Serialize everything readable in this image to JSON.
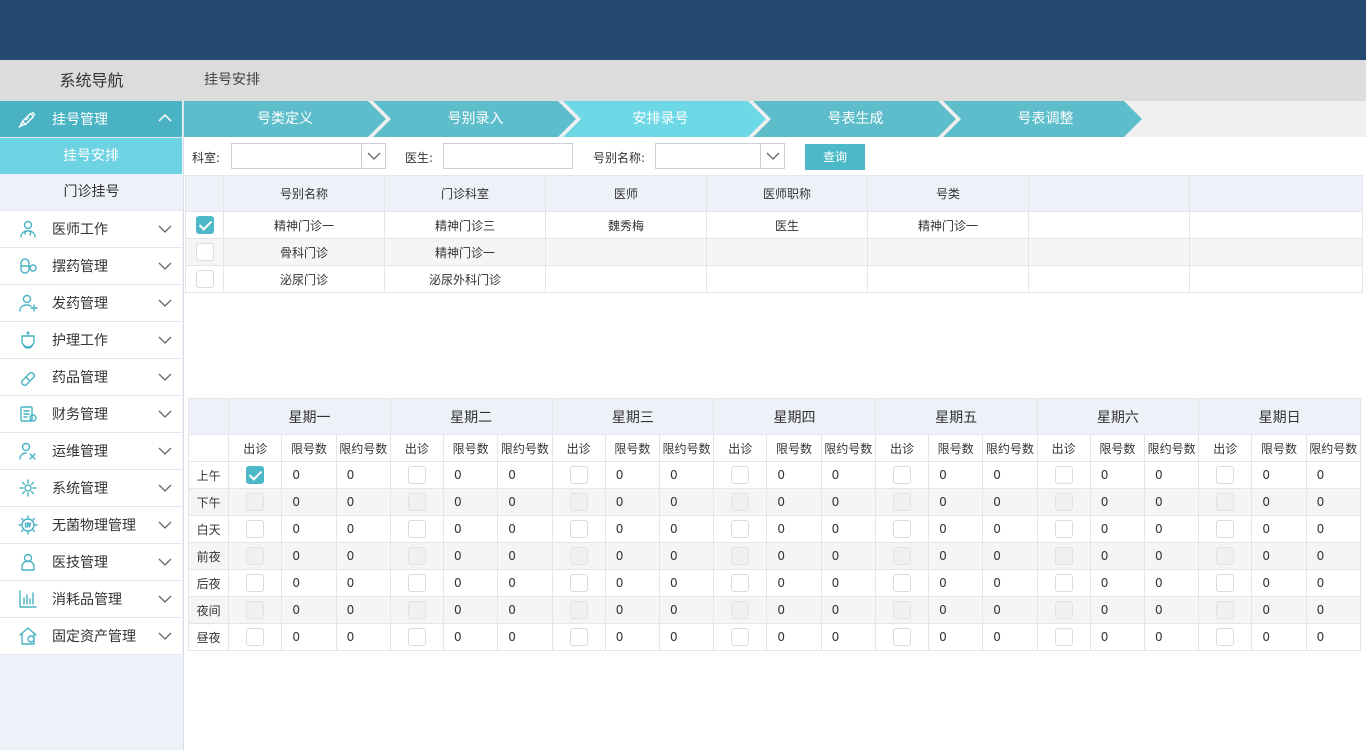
{
  "sidebar": {
    "title": "系统导航",
    "active_group": "挂号管理",
    "active_sub": "挂号安排",
    "sub_plain": "门诊挂号",
    "items": [
      {
        "label": "医师工作",
        "icon": "doctor-icon"
      },
      {
        "label": "摆药管理",
        "icon": "pill-icon"
      },
      {
        "label": "发药管理",
        "icon": "dispense-icon"
      },
      {
        "label": "护理工作",
        "icon": "nurse-icon"
      },
      {
        "label": "药品管理",
        "icon": "capsule-icon"
      },
      {
        "label": "财务管理",
        "icon": "finance-icon"
      },
      {
        "label": "运维管理",
        "icon": "maintenance-icon"
      },
      {
        "label": "系统管理",
        "icon": "gear-icon"
      },
      {
        "label": "无菌物理管理",
        "icon": "uv-icon"
      },
      {
        "label": "医技管理",
        "icon": "technician-icon"
      },
      {
        "label": "消耗品管理",
        "icon": "chart-bars-icon"
      },
      {
        "label": "固定资产管理",
        "icon": "house-money-icon"
      }
    ]
  },
  "breadcrumb": "挂号安排",
  "steps": [
    {
      "label": "号类定义",
      "active": false
    },
    {
      "label": "号别录入",
      "active": false
    },
    {
      "label": "安排录号",
      "active": true
    },
    {
      "label": "号表生成",
      "active": false
    },
    {
      "label": "号表调整",
      "active": false
    }
  ],
  "filters": {
    "dept_label": "科室:",
    "doctor_label": "医生:",
    "name_label": "号别名称:",
    "dept_value": "",
    "doctor_value": "",
    "name_value": "",
    "query_button": "查询"
  },
  "reg_table": {
    "headers": [
      "号别名称",
      "门诊科室",
      "医师",
      "医师职称",
      "号类",
      "",
      ""
    ],
    "rows": [
      {
        "checked": true,
        "cells": [
          "精神门诊一",
          "精神门诊三",
          "魏秀梅",
          "医生",
          "精神门诊一",
          "",
          ""
        ]
      },
      {
        "checked": false,
        "cells": [
          "骨科门诊",
          "精神门诊一",
          "",
          "",
          "",
          "",
          ""
        ]
      },
      {
        "checked": false,
        "cells": [
          "泌尿门诊",
          "泌尿外科门诊",
          "",
          "",
          "",
          "",
          ""
        ]
      }
    ]
  },
  "schedule": {
    "days": [
      "星期一",
      "星期二",
      "星期三",
      "星期四",
      "星期五",
      "星期六",
      "星期日"
    ],
    "sub_headers": [
      "出诊",
      "限号数",
      "限约号数"
    ],
    "periods": [
      {
        "label": "上午",
        "clinic": [
          true,
          false,
          false,
          false,
          false,
          false,
          false
        ],
        "limit": [
          "0",
          "0",
          "0",
          "0",
          "0",
          "0",
          "0"
        ],
        "appt": [
          "0",
          "0",
          "0",
          "0",
          "0",
          "0",
          "0"
        ]
      },
      {
        "label": "下午",
        "clinic": [
          false,
          false,
          false,
          false,
          false,
          false,
          false
        ],
        "limit": [
          "0",
          "0",
          "0",
          "0",
          "0",
          "0",
          "0"
        ],
        "appt": [
          "0",
          "0",
          "0",
          "0",
          "0",
          "0",
          "0"
        ]
      },
      {
        "label": "白天",
        "clinic": [
          false,
          false,
          false,
          false,
          false,
          false,
          false
        ],
        "limit": [
          "0",
          "0",
          "0",
          "0",
          "0",
          "0",
          "0"
        ],
        "appt": [
          "0",
          "0",
          "0",
          "0",
          "0",
          "0",
          "0"
        ]
      },
      {
        "label": "前夜",
        "clinic": [
          false,
          false,
          false,
          false,
          false,
          false,
          false
        ],
        "limit": [
          "0",
          "0",
          "0",
          "0",
          "0",
          "0",
          "0"
        ],
        "appt": [
          "0",
          "0",
          "0",
          "0",
          "0",
          "0",
          "0"
        ]
      },
      {
        "label": "后夜",
        "clinic": [
          false,
          false,
          false,
          false,
          false,
          false,
          false
        ],
        "limit": [
          "0",
          "0",
          "0",
          "0",
          "0",
          "0",
          "0"
        ],
        "appt": [
          "0",
          "0",
          "0",
          "0",
          "0",
          "0",
          "0"
        ]
      },
      {
        "label": "夜间",
        "clinic": [
          false,
          false,
          false,
          false,
          false,
          false,
          false
        ],
        "limit": [
          "0",
          "0",
          "0",
          "0",
          "0",
          "0",
          "0"
        ],
        "appt": [
          "0",
          "0",
          "0",
          "0",
          "0",
          "0",
          "0"
        ]
      },
      {
        "label": "昼夜",
        "clinic": [
          false,
          false,
          false,
          false,
          false,
          false,
          false
        ],
        "limit": [
          "0",
          "0",
          "0",
          "0",
          "0",
          "0",
          "0"
        ],
        "appt": [
          "0",
          "0",
          "0",
          "0",
          "0",
          "0",
          "0"
        ]
      }
    ]
  },
  "colors": {
    "header_bg": "#254a72",
    "accent": "#49b3c4",
    "step": "#5dbdca",
    "step_active": "#6dd8e6"
  }
}
